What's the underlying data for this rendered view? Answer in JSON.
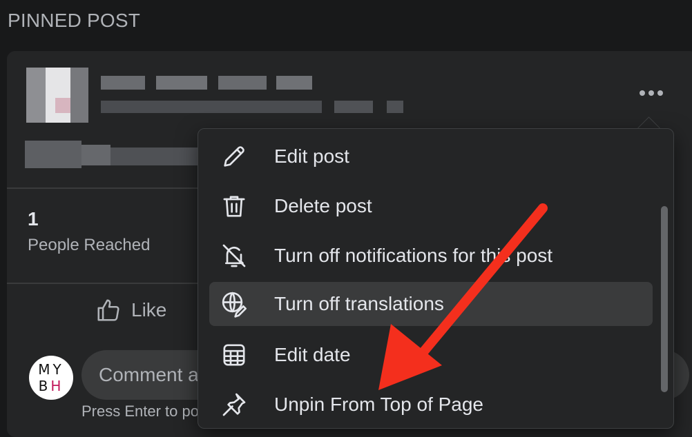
{
  "section": {
    "title": "PINNED POST"
  },
  "post": {
    "more_icon": "more-horizontal-icon",
    "stats": {
      "count": "1",
      "label": "People Reached"
    },
    "actions": {
      "like_label": "Like",
      "like_icon": "thumbs-up-icon"
    },
    "comment": {
      "avatar_line1": "MY",
      "avatar_line2_a": "B",
      "avatar_line2_b": "H",
      "placeholder": "Comment as MYBH",
      "hint": "Press Enter to post."
    }
  },
  "menu": {
    "items": [
      {
        "label": "Edit post",
        "icon": "pencil-icon"
      },
      {
        "label": "Delete post",
        "icon": "trash-icon"
      },
      {
        "label": "Turn off notifications for this post",
        "icon": "bell-off-icon"
      },
      {
        "label": "Turn off translations",
        "icon": "globe-translate-icon",
        "hovered": true
      },
      {
        "label": "Edit date",
        "icon": "calendar-icon"
      },
      {
        "label": "Unpin From Top of Page",
        "icon": "pin-icon"
      }
    ]
  },
  "colors": {
    "background": "#18191a",
    "card": "#242526",
    "text_primary": "#e4e6eb",
    "text_secondary": "#b0b3b8",
    "hover": "#3a3b3c",
    "annotation_arrow": "#f42f1d"
  }
}
